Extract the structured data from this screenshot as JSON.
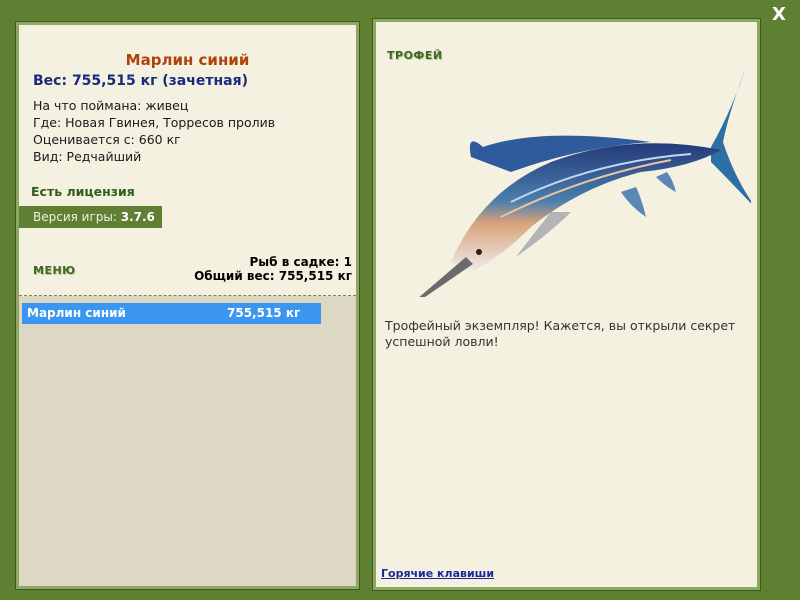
{
  "window": {
    "close_label": "X"
  },
  "fish": {
    "title": "Марлин синий",
    "weight_line": "Вес: 755,515 кг (зачетная)",
    "info": [
      "На что поймана: живец",
      "Где: Новая Гвинея, Торресов пролив",
      "Оценивается с: 660 кг",
      "Вид: Редчайший"
    ]
  },
  "license": "Есть лицензия",
  "version": {
    "label": "Версия игры: ",
    "value": "3.7.6"
  },
  "menu": {
    "label": "МЕНЮ"
  },
  "keepnet": {
    "count": "Рыб в садке: 1",
    "total": "Общий вес: 755,515 кг"
  },
  "catch_list": [
    {
      "name": "Марлин синий",
      "weight": "755,515 кг"
    }
  ],
  "trophy": {
    "label": "ТРОФЕЙ",
    "description": "Трофейный экземпляр! Кажется, вы открыли секрет успешной ловли!",
    "image_icon": "blue-marlin-image"
  },
  "hotkeys": "Горячие клавиши",
  "colors": {
    "frame": "#5f7f33",
    "panel": "#f4f1e0",
    "title": "#b0420b",
    "weight": "#1b2a7b",
    "selected": "#3a96f0"
  }
}
